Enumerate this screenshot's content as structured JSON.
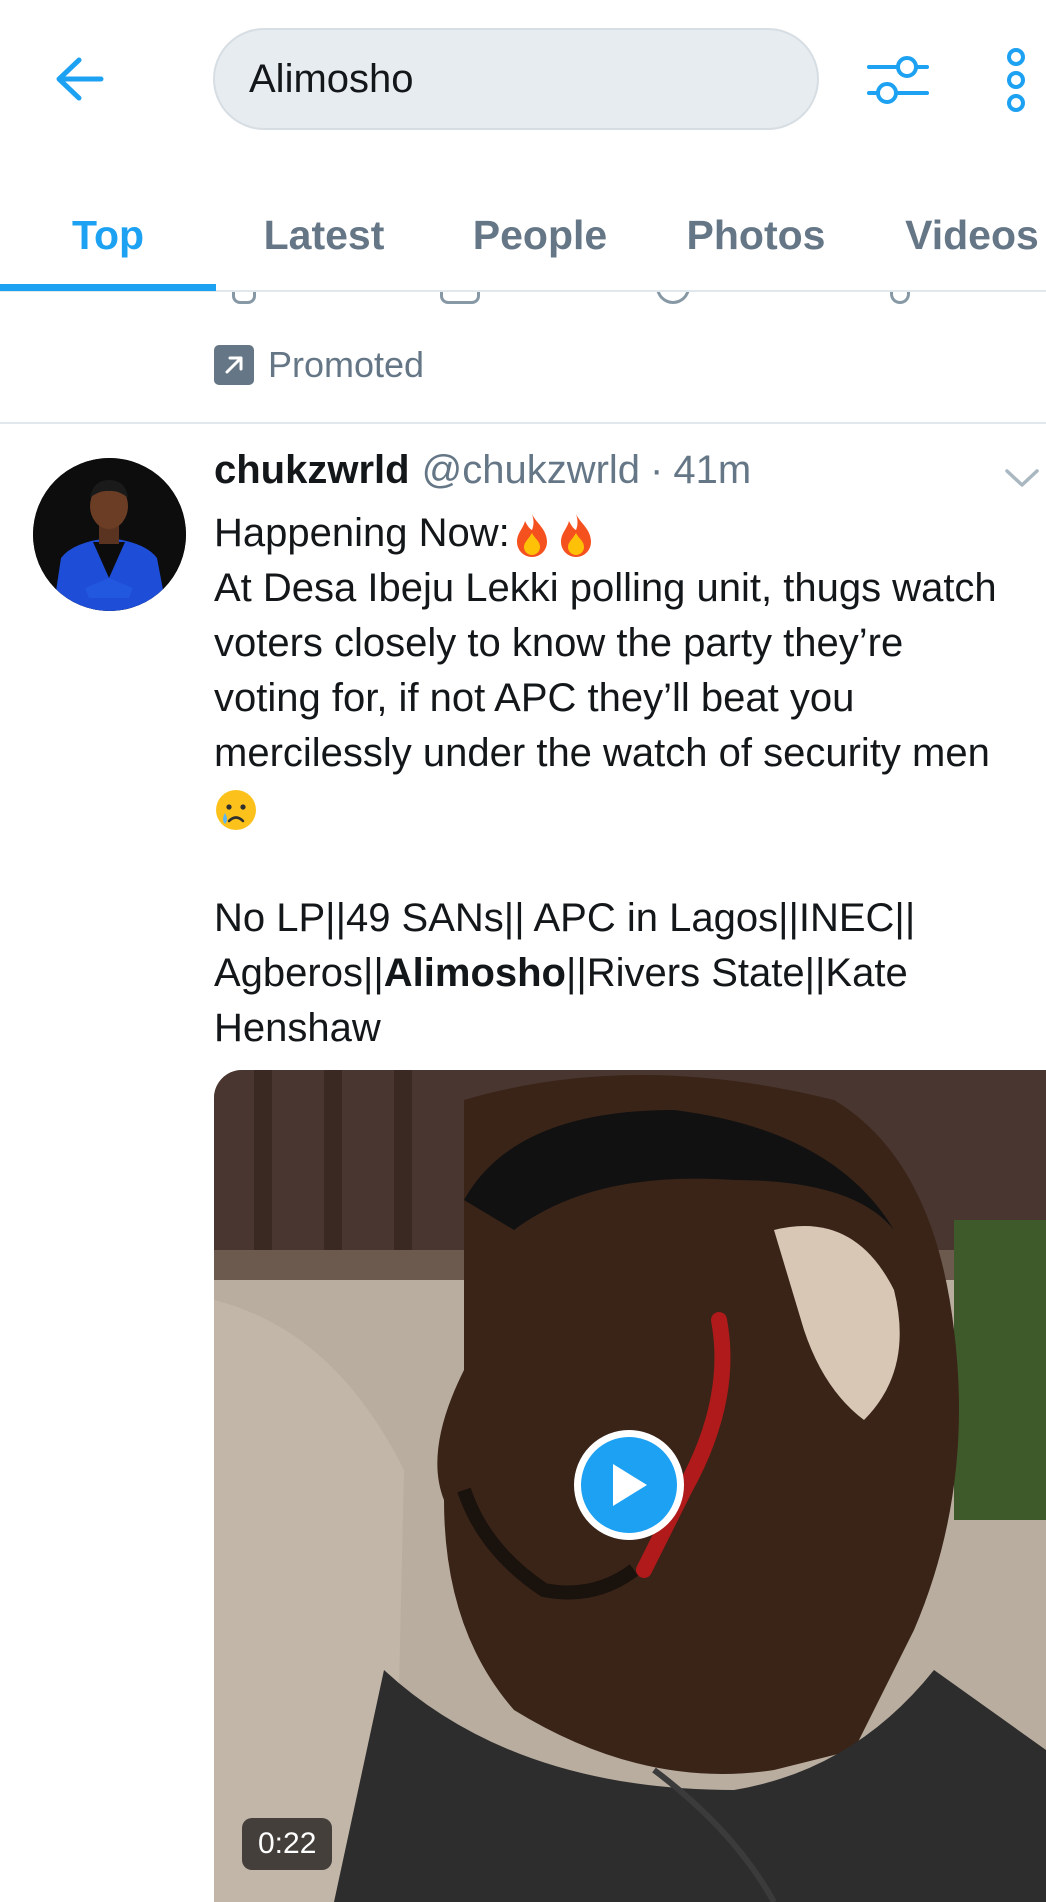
{
  "search": {
    "query": "Alimosho"
  },
  "tabs": [
    {
      "label": "Top",
      "active": true
    },
    {
      "label": "Latest",
      "active": false
    },
    {
      "label": "People",
      "active": false
    },
    {
      "label": "Photos",
      "active": false
    },
    {
      "label": "Videos",
      "active": false
    }
  ],
  "promoted": {
    "label": "Promoted"
  },
  "tweet": {
    "display_name": "chukzwrld",
    "handle": "@chukzwrld",
    "separator": "·",
    "time": "41m",
    "lines": {
      "l1": "Happening Now:",
      "l2": "At Desa Ibeju Lekki polling unit, thugs watch",
      "l3": "voters closely to know the party they’re",
      "l4": "voting for, if not APC they’ll beat you",
      "l5": "mercilessly under the watch of security men",
      "l7a": "No LP||49 SANs|| APC in Lagos||INEC||",
      "l8a": "Agberos||",
      "l8b": "Alimosho",
      "l8c": "||Rivers State||Kate",
      "l9": "Henshaw"
    },
    "emojis": [
      "fire",
      "fire",
      "crying-face"
    ],
    "media": {
      "type": "video",
      "duration": "0:22"
    }
  },
  "colors": {
    "accent": "#1da1f2",
    "secondary_text": "#657786",
    "divider": "#e1e8ed",
    "search_bg": "#e6ecf0"
  },
  "icons": [
    "back-arrow-icon",
    "filter-sliders-icon",
    "more-vertical-icon",
    "promoted-arrow-icon",
    "chevron-down-icon",
    "play-icon"
  ]
}
